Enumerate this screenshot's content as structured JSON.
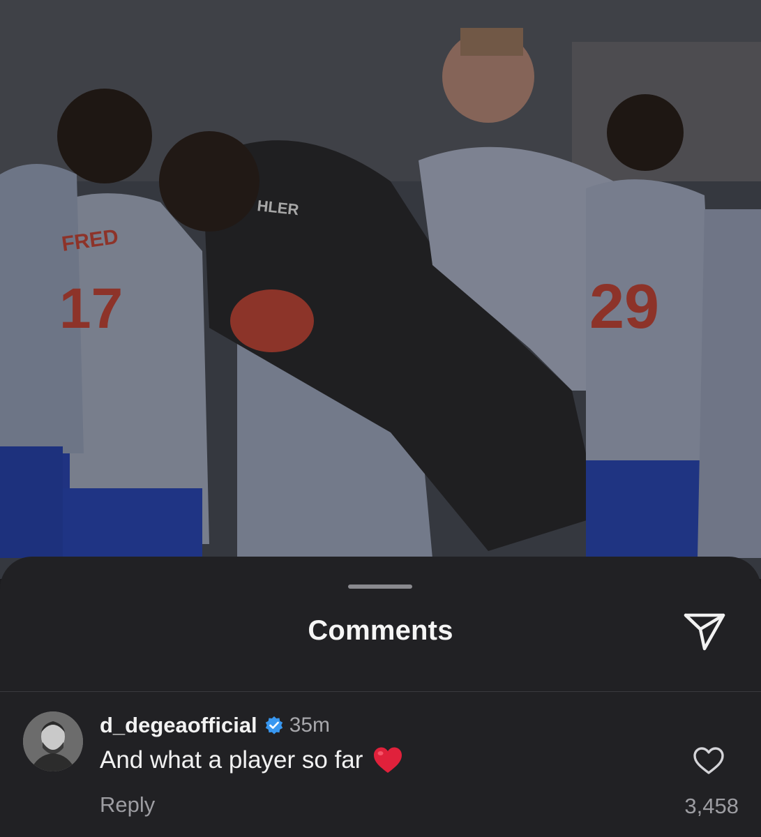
{
  "post": {
    "jersey_numbers": [
      "17",
      "29"
    ],
    "jersey_name": "FRED",
    "sponsor_text": "HLER"
  },
  "sheet": {
    "title": "Comments",
    "share_icon": "paper-plane-icon"
  },
  "comment": {
    "username": "d_degeaofficial",
    "verified_icon": "verified-badge-icon",
    "time": "35m",
    "text": "And what a player so far",
    "emoji": "red-heart",
    "reply_label": "Reply",
    "like_icon": "heart-outline-icon",
    "like_count": "3,458"
  },
  "colors": {
    "sheet_bg": "#212124",
    "verified_blue": "#3897f0",
    "heart_red": "#e0213b"
  }
}
